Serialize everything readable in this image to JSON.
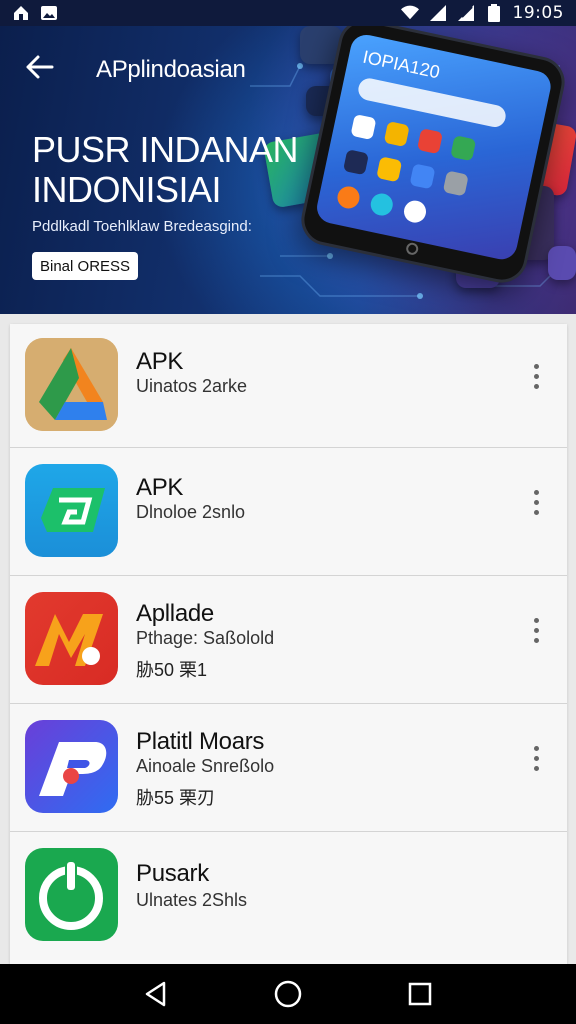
{
  "status_bar": {
    "time": "19:05",
    "left_icons": [
      "home-notification-icon",
      "gallery-notification-icon"
    ],
    "right_icons": [
      "wifi-icon",
      "signal-icon",
      "signal-alt-icon",
      "battery-icon"
    ]
  },
  "header": {
    "back_icon": "arrow-left-icon",
    "app_title": "APplindoasian"
  },
  "hero": {
    "title_line1": "PUSR INDANAN",
    "title_line2": "INDONISIAI",
    "subtitle": "Pddlkadl Toehlklaw Bredeasgind:",
    "chip_label": "Binal ORESS",
    "phone_text": "IOPIA120"
  },
  "apps": [
    {
      "name": "APK",
      "subtitle": "Uinatos 2arke",
      "extra": "",
      "icon": "triangle-drive-icon",
      "colors": [
        "#d1a35c",
        "#2f80ed",
        "#f2841e",
        "#2e9a4a"
      ]
    },
    {
      "name": "APK",
      "subtitle": "Dlnoloe 2snlo",
      "extra": "",
      "icon": "green-square-icon",
      "colors": [
        "#1fa7e8",
        "#1cc06a"
      ]
    },
    {
      "name": "Apllade",
      "subtitle": "Pthage: Saßolold",
      "extra": "胁50 栗1",
      "icon": "red-m-icon",
      "colors": [
        "#e23a2e",
        "#f7a21b"
      ]
    },
    {
      "name": "Platitl Moars",
      "subtitle": "Ainoale Snreßolo",
      "extra": "胁55 栗刃",
      "icon": "purple-p-icon",
      "colors": [
        "#5a3fd8",
        "#2f6cf2",
        "#e94545"
      ]
    },
    {
      "name": "Pusark",
      "subtitle": "Ulnates 2Shls",
      "extra": "",
      "icon": "green-power-icon",
      "colors": [
        "#1aa84f"
      ]
    }
  ],
  "nav": {
    "back": "back-triangle-icon",
    "home": "home-circle-icon",
    "recents": "recents-square-icon"
  }
}
